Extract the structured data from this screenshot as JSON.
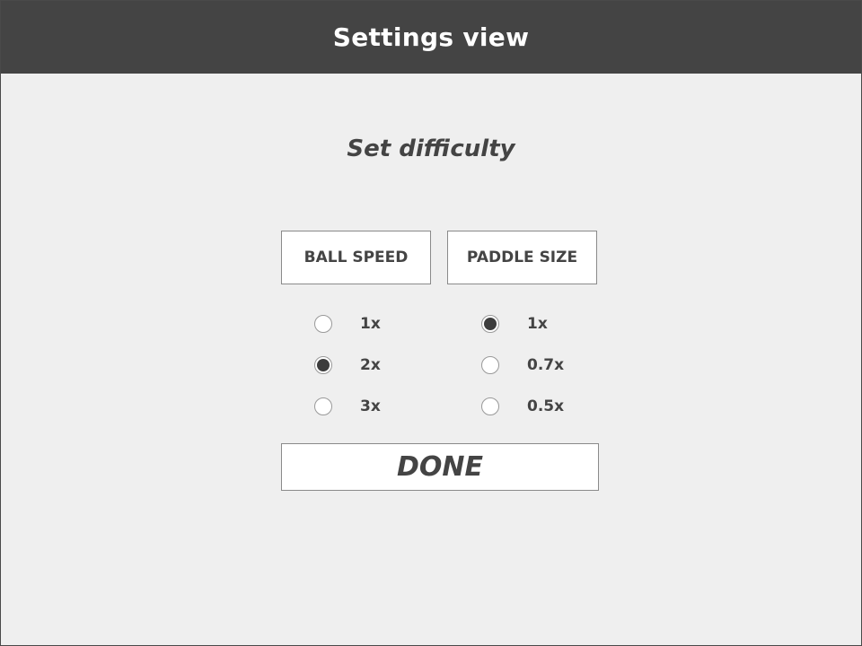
{
  "header": {
    "title": "Settings view"
  },
  "main": {
    "subtitle": "Set difficulty",
    "tabs": [
      {
        "label": "BALL SPEED"
      },
      {
        "label": "PADDLE SIZE"
      }
    ],
    "ball_speed": {
      "options": [
        {
          "label": "1x",
          "selected": false
        },
        {
          "label": "2x",
          "selected": true
        },
        {
          "label": "3x",
          "selected": false
        }
      ]
    },
    "paddle_size": {
      "options": [
        {
          "label": "1x",
          "selected": true
        },
        {
          "label": "0.7x",
          "selected": false
        },
        {
          "label": "0.5x",
          "selected": false
        }
      ]
    },
    "done_label": "DONE"
  },
  "colors": {
    "header_bg": "#444444",
    "page_bg": "#efefef",
    "text": "#444444",
    "radio_selected": "#3d3d3d"
  }
}
